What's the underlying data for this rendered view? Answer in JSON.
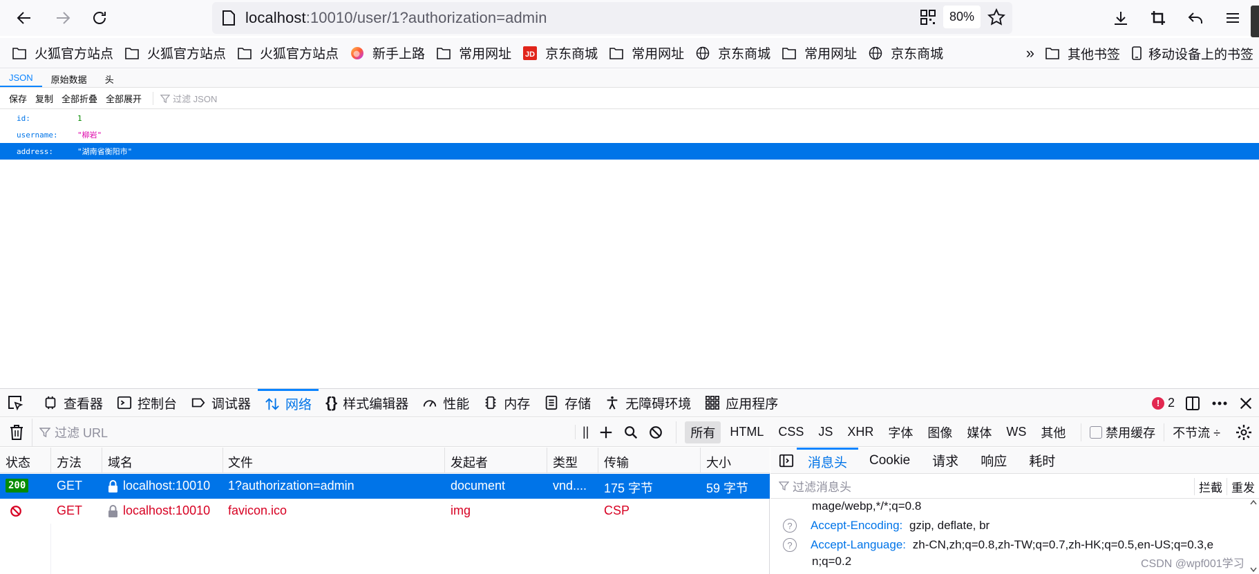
{
  "nav": {
    "url_host": "localhost",
    "url_rest": ":10010/user/1?authorization=admin",
    "zoom": "80%"
  },
  "bookmarks": [
    {
      "label": "火狐官方站点",
      "icon": "folder-icon"
    },
    {
      "label": "火狐官方站点",
      "icon": "folder-icon"
    },
    {
      "label": "火狐官方站点",
      "icon": "folder-icon"
    },
    {
      "label": "新手上路",
      "icon": "firefox-icon"
    },
    {
      "label": "常用网址",
      "icon": "folder-icon"
    },
    {
      "label": "京东商城",
      "icon": "jd-icon"
    },
    {
      "label": "常用网址",
      "icon": "folder-icon"
    },
    {
      "label": "京东商城",
      "icon": "globe-icon"
    },
    {
      "label": "常用网址",
      "icon": "folder-icon"
    },
    {
      "label": "京东商城",
      "icon": "globe-icon"
    }
  ],
  "bookmarks_right": {
    "other": "其他书签",
    "mobile": "移动设备上的书签"
  },
  "json_viewer": {
    "tabs": [
      "JSON",
      "原始数据",
      "头"
    ],
    "toolbar": [
      "保存",
      "复制",
      "全部折叠",
      "全部展开"
    ],
    "filter_placeholder": "过滤 JSON",
    "rows": [
      {
        "key": "id:",
        "value": "1"
      },
      {
        "key": "username:",
        "value": "\"柳岩\""
      },
      {
        "key": "address:",
        "value": "\"湖南省衡阳市\""
      }
    ]
  },
  "devtools": {
    "tabs": [
      "查看器",
      "控制台",
      "调试器",
      "网络",
      "样式编辑器",
      "性能",
      "内存",
      "存储",
      "无障碍环境",
      "应用程序"
    ],
    "error_count": "2",
    "filter_url_placeholder": "过滤 URL",
    "pause_label": "||",
    "type_filters": [
      "所有",
      "HTML",
      "CSS",
      "JS",
      "XHR",
      "字体",
      "图像",
      "媒体",
      "WS",
      "其他"
    ],
    "disable_cache": "禁用缓存",
    "throttle": "不节流 ÷",
    "columns": [
      "状态",
      "方法",
      "域名",
      "文件",
      "发起者",
      "类型",
      "传输",
      "大小"
    ],
    "requests": [
      {
        "status": "200",
        "method": "GET",
        "domain": "localhost:10010",
        "file": "1?authorization=admin",
        "initiator": "document",
        "type": "vnd....",
        "transferred": "175 字节",
        "size": "59 字节"
      },
      {
        "status": "",
        "method": "GET",
        "domain": "localhost:10010",
        "file": "favicon.ico",
        "initiator": "img",
        "type": "",
        "transferred": "CSP",
        "size": ""
      }
    ],
    "side_tabs": [
      "消息头",
      "Cookie",
      "请求",
      "响应",
      "耗时"
    ],
    "header_filter_placeholder": "过滤消息头",
    "header_buttons": [
      "拦截",
      "重发"
    ],
    "headers": {
      "accept_tail": "mage/webp,*/*;q=0.8",
      "encoding_name": "Accept-Encoding:",
      "encoding_value": "gzip, deflate, br",
      "language_name": "Accept-Language:",
      "language_value": "zh-CN,zh;q=0.8,zh-TW;q=0.7,zh-HK;q=0.5,en-US;q=0.3,e",
      "language_value_2": "n;q=0.2"
    },
    "watermark": "CSDN @wpf001学习"
  }
}
